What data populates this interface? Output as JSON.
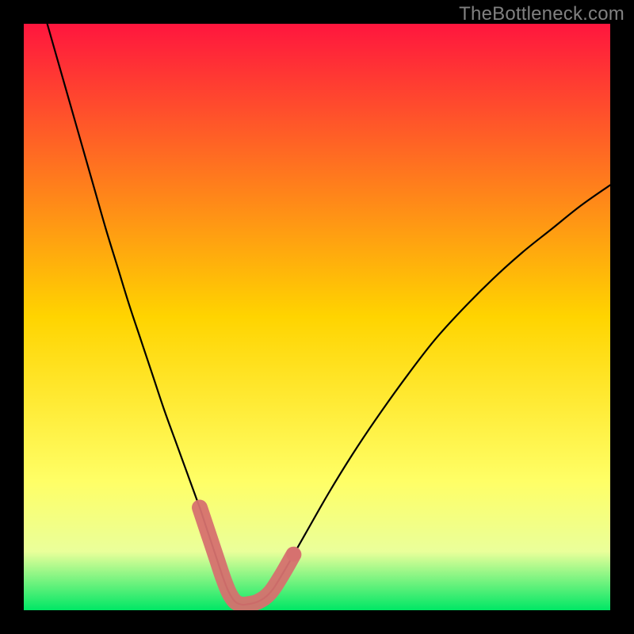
{
  "watermark": "TheBottleneck.com",
  "colors": {
    "bg": "#000000",
    "grad_top": "#ff163e",
    "grad_mid": "#ffd400",
    "grad_green_light": "#eaff9a",
    "grad_green": "#00e765",
    "curve": "#000000",
    "marker": "#d6716f",
    "marker_stroke": "#c7605e"
  },
  "chart_data": {
    "type": "line",
    "title": "",
    "xlabel": "",
    "ylabel": "",
    "xlim": [
      0,
      100
    ],
    "ylim": [
      0,
      100
    ],
    "series": [
      {
        "name": "bottleneck-curve",
        "x": [
          4,
          6,
          8,
          10,
          12,
          14,
          16,
          18,
          20,
          22,
          24,
          26,
          28,
          30,
          31,
          32,
          33,
          34,
          35,
          36,
          37,
          38,
          40,
          42,
          44,
          48,
          52,
          56,
          60,
          65,
          70,
          75,
          80,
          85,
          90,
          95,
          100
        ],
        "values": [
          100,
          93,
          86,
          79,
          72,
          65,
          58.5,
          52,
          46,
          40,
          34,
          28.5,
          23,
          17.5,
          14.5,
          11.5,
          8.5,
          5.5,
          3,
          1.5,
          1,
          1,
          1.5,
          3,
          6,
          13,
          20,
          26.5,
          32.5,
          39.5,
          46,
          51.5,
          56.5,
          61,
          65,
          69,
          72.5
        ]
      }
    ],
    "markers": [
      {
        "x": 30,
        "y": 17.5
      },
      {
        "x": 31,
        "y": 14.5
      },
      {
        "x": 32,
        "y": 11.5
      },
      {
        "x": 33,
        "y": 8.5
      },
      {
        "x": 34,
        "y": 5.5
      },
      {
        "x": 35,
        "y": 3
      },
      {
        "x": 36,
        "y": 1.5
      },
      {
        "x": 37,
        "y": 1
      },
      {
        "x": 38,
        "y": 1
      },
      {
        "x": 40,
        "y": 1.5
      },
      {
        "x": 42,
        "y": 3
      },
      {
        "x": 44,
        "y": 6
      },
      {
        "x": 46,
        "y": 9.5
      }
    ]
  }
}
